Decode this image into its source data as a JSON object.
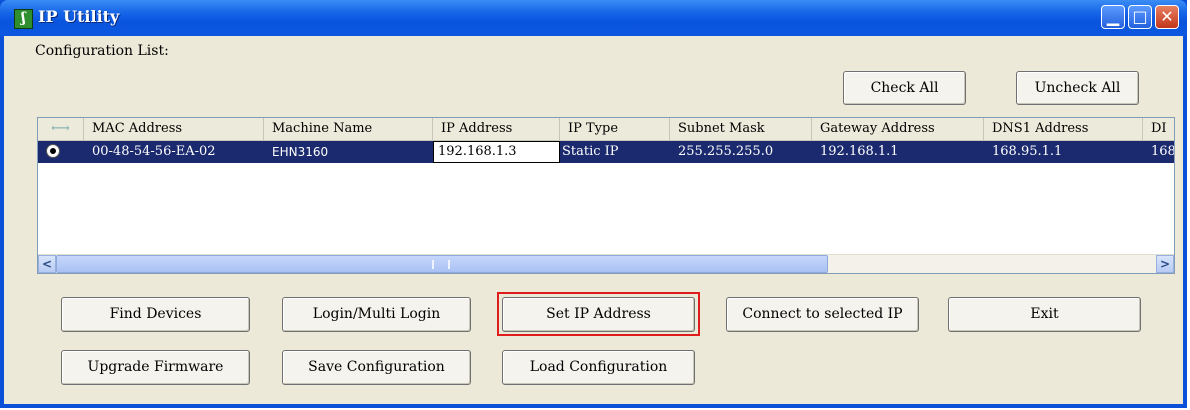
{
  "window": {
    "title": "IP Utility"
  },
  "config": {
    "label": "Configuration List:",
    "check_all": "Check All",
    "uncheck_all": "Uncheck All"
  },
  "table": {
    "columns": [
      "MAC Address",
      "Machine Name",
      "IP Address",
      "IP Type",
      "Subnet Mask",
      "Gateway Address",
      "DNS1 Address",
      "DI"
    ],
    "rows": [
      {
        "mac": "00-48-54-56-EA-02",
        "machine": "EHN3160",
        "ip": "192.168.1.3",
        "type": "Static IP",
        "subnet": "255.255.255.0",
        "gateway": "192.168.1.1",
        "dns1": "168.95.1.1",
        "dns2": "168"
      }
    ]
  },
  "buttons": {
    "find_devices": "Find Devices",
    "login": "Login/Multi Login",
    "set_ip": "Set IP Address",
    "connect": "Connect to selected IP",
    "exit": "Exit",
    "upgrade": "Upgrade Firmware",
    "save": "Save Configuration",
    "load": "Load Configuration"
  },
  "colors": {
    "selected_row": "#1b2a6e",
    "highlight": "#e01d1d",
    "titlebar": "#0a54de"
  }
}
